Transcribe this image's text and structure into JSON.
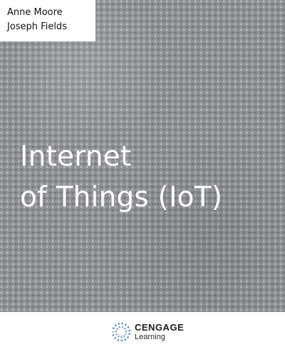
{
  "authors": [
    "Anne Moore",
    "Joseph Fields"
  ],
  "title": {
    "line1": "Internet",
    "line2": "of Things (IoT)"
  },
  "publisher": {
    "name": "CENGAGE",
    "subname": "Learning"
  },
  "colors": {
    "cover_background": "#8f9398",
    "title_text": "#ffffff",
    "logo_blue": "#2d79c7"
  },
  "icons": {
    "publisher_logo": "cengage-logo-icon"
  }
}
